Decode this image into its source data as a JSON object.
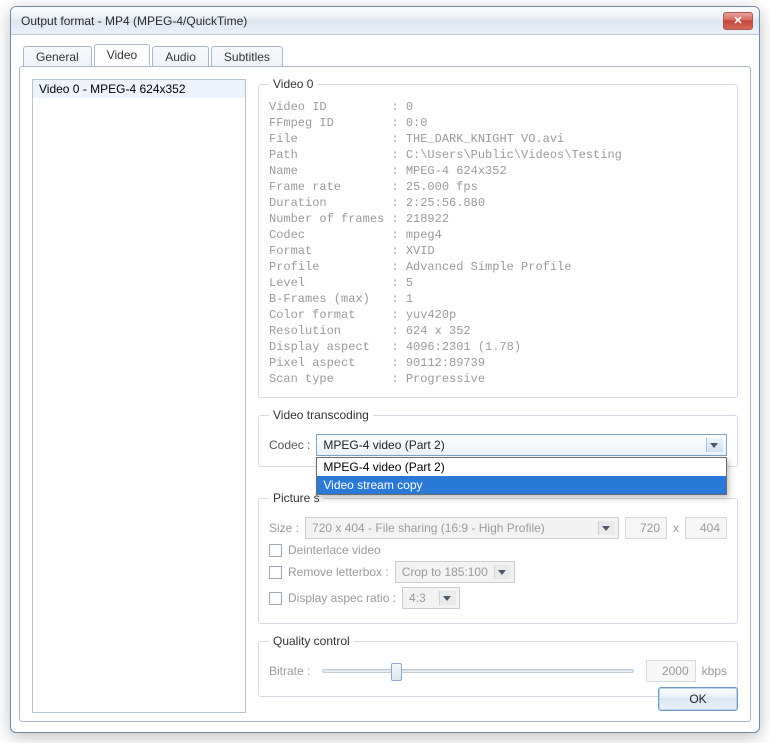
{
  "window": {
    "title": "Output format - MP4 (MPEG-4/QuickTime)"
  },
  "tabs": {
    "general": "General",
    "video": "Video",
    "audio": "Audio",
    "subtitles": "Subtitles"
  },
  "stream_list": {
    "item0": "Video 0 - MPEG-4 624x352"
  },
  "video0": {
    "legend": "Video 0",
    "labels": {
      "video_id": "Video ID",
      "ffmpeg_id": "FFmpeg ID",
      "file": "File",
      "path": "Path",
      "name": "Name",
      "frame_rate": "Frame rate",
      "duration": "Duration",
      "num_frames": "Number of frames",
      "codec": "Codec",
      "format": "Format",
      "profile": "Profile",
      "level": "Level",
      "bframes": "B-Frames (max)",
      "color_fmt": "Color format",
      "resolution": "Resolution",
      "disp_aspect": "Display aspect",
      "pix_aspect": "Pixel aspect",
      "scan": "Scan type"
    },
    "values": {
      "video_id": "0",
      "ffmpeg_id": "0:0",
      "file": "THE_DARK_KNIGHT VO.avi",
      "path": "C:\\Users\\Public\\Videos\\Testing",
      "name": "MPEG-4 624x352",
      "frame_rate": "25.000 fps",
      "duration": "2:25:56.880",
      "num_frames": "218922",
      "codec": "mpeg4",
      "format": "XVID",
      "profile": "Advanced Simple Profile",
      "level": "5",
      "bframes": "1",
      "color_fmt": "yuv420p",
      "resolution": "624 x 352",
      "disp_aspect": "4096:2301 (1.78)",
      "pix_aspect": "90112:89739",
      "scan": "Progressive"
    }
  },
  "transcoding": {
    "legend": "Video transcoding",
    "codec_label": "Codec :",
    "codec_selected": "MPEG-4 video (Part 2)",
    "codec_options": {
      "opt0": "MPEG-4 video (Part 2)",
      "opt1": "Video stream copy"
    }
  },
  "picture": {
    "legend_prefix": "Picture s",
    "size_label": "Size :",
    "size_preset": "720 x 404  -  File sharing (16:9 - High Profile)",
    "width": "720",
    "x": "x",
    "height": "404",
    "deinterlace": "Deinterlace video",
    "remove_lb": "Remove letterbox :",
    "crop_preset": "Crop to 185:100",
    "dar": "Display aspec ratio :",
    "dar_value": "4:3"
  },
  "quality": {
    "legend": "Quality control",
    "bitrate_label": "Bitrate :",
    "bitrate_value": "2000",
    "bitrate_unit": "kbps"
  },
  "buttons": {
    "ok": "OK"
  }
}
